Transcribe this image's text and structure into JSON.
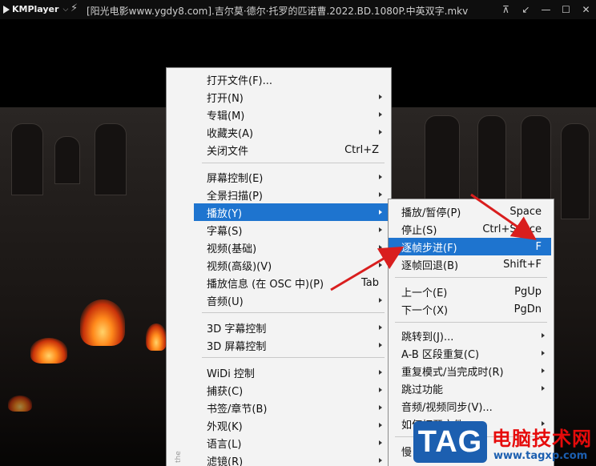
{
  "titlebar": {
    "app_name": "KMPlayer",
    "window_title": "[阳光电影www.ygdy8.com].吉尔莫·德尔·托罗的匹诺曹.2022.BD.1080P.中英双字.mkv",
    "buttons": [
      "pin-icon",
      "minimize-to-corner-icon",
      "minimize-icon",
      "maximize-icon",
      "close-icon"
    ]
  },
  "main_menu": {
    "items": [
      {
        "label": "打开文件(F)...",
        "shortcut": "",
        "submenu": false
      },
      {
        "label": "打开(N)",
        "shortcut": "",
        "submenu": true
      },
      {
        "label": "专辑(M)",
        "shortcut": "",
        "submenu": true
      },
      {
        "label": "收藏夹(A)",
        "shortcut": "",
        "submenu": true
      },
      {
        "label": "关闭文件",
        "shortcut": "Ctrl+Z",
        "submenu": false
      },
      {
        "label": "屏幕控制(E)",
        "shortcut": "",
        "submenu": true
      },
      {
        "label": "全景扫描(P)",
        "shortcut": "",
        "submenu": true
      },
      {
        "label": "播放(Y)",
        "shortcut": "",
        "submenu": true
      },
      {
        "label": "字幕(S)",
        "shortcut": "",
        "submenu": true
      },
      {
        "label": "视频(基础)",
        "shortcut": "",
        "submenu": true
      },
      {
        "label": "视频(高级)(V)",
        "shortcut": "",
        "submenu": true
      },
      {
        "label": "播放信息 (在 OSC 中)(P)",
        "shortcut": "Tab",
        "submenu": false
      },
      {
        "label": "音频(U)",
        "shortcut": "",
        "submenu": true
      },
      {
        "label": "3D 字幕控制",
        "shortcut": "",
        "submenu": true
      },
      {
        "label": "3D 屏幕控制",
        "shortcut": "",
        "submenu": true
      },
      {
        "label": "WiDi 控制",
        "shortcut": "",
        "submenu": true
      },
      {
        "label": "捕获(C)",
        "shortcut": "",
        "submenu": true
      },
      {
        "label": "书签/章节(B)",
        "shortcut": "",
        "submenu": true
      },
      {
        "label": "外观(K)",
        "shortcut": "",
        "submenu": true
      },
      {
        "label": "语言(L)",
        "shortcut": "",
        "submenu": true
      },
      {
        "label": "滤镜(R)",
        "shortcut": "",
        "submenu": true
      }
    ],
    "highlighted": "播放(Y)"
  },
  "play_submenu": {
    "items": [
      {
        "label": "播放/暂停(P)",
        "shortcut": "Space",
        "submenu": false
      },
      {
        "label": "停止(S)",
        "shortcut": "Ctrl+Space",
        "submenu": false
      },
      {
        "label": "逐帧步进(F)",
        "shortcut": "F",
        "submenu": false
      },
      {
        "label": "逐帧回退(B)",
        "shortcut": "Shift+F",
        "submenu": false
      },
      {
        "label": "上一个(E)",
        "shortcut": "PgUp",
        "submenu": false
      },
      {
        "label": "下一个(X)",
        "shortcut": "PgDn",
        "submenu": false
      },
      {
        "label": "跳转到(J)...",
        "shortcut": "",
        "submenu": true
      },
      {
        "label": "A-B 区段重复(C)",
        "shortcut": "",
        "submenu": true
      },
      {
        "label": "重复模式/当完成时(R)",
        "shortcut": "",
        "submenu": true
      },
      {
        "label": "跳过功能",
        "shortcut": "",
        "submenu": true
      },
      {
        "label": "音频/视频同步(V)...",
        "shortcut": "",
        "submenu": false
      },
      {
        "label": "如何打开文件",
        "shortcut": "",
        "submenu": true
      },
      {
        "label": "慢",
        "shortcut": "",
        "submenu": false
      }
    ],
    "highlighted": "逐帧步进(F)"
  },
  "watermark": {
    "badge": "TAG",
    "site_name": "电脑技术网",
    "url": "www.tagxp.com"
  },
  "colors": {
    "highlight": "#1e74cf",
    "menu_bg": "#f3f3f3",
    "annotation_arrow": "#d91e1e",
    "watermark_red": "#e60b0b",
    "watermark_blue": "#1c5fb0"
  }
}
